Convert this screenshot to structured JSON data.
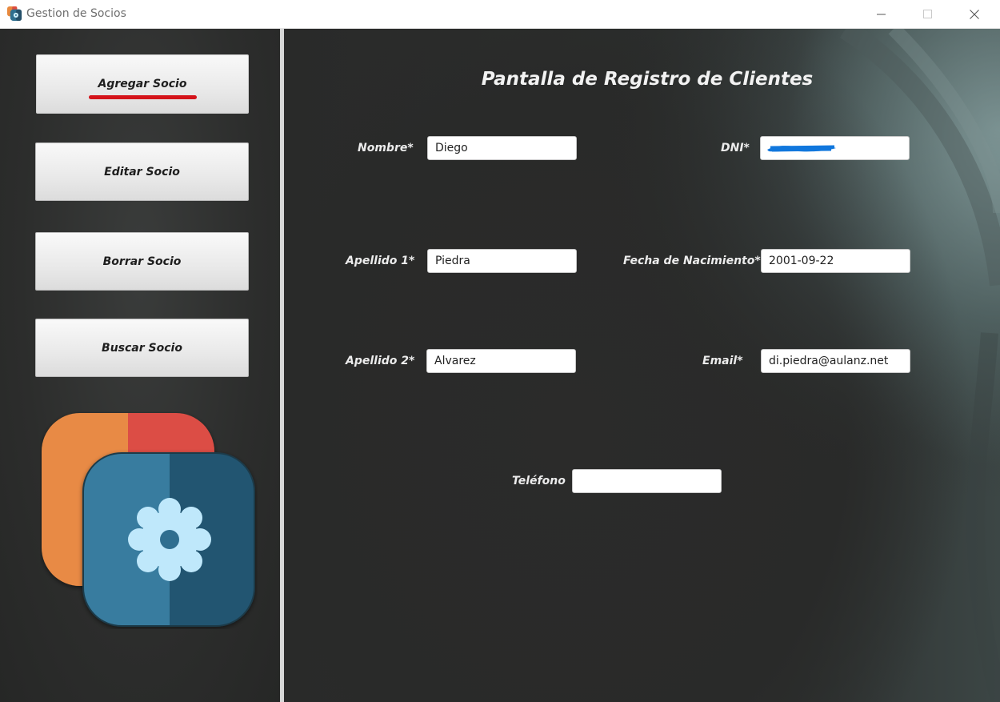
{
  "window": {
    "title": "Gestion de Socios"
  },
  "sidebar": {
    "buttons": [
      {
        "label": "Agregar Socio"
      },
      {
        "label": "Editar Socio"
      },
      {
        "label": "Borrar Socio"
      },
      {
        "label": "Buscar Socio"
      }
    ],
    "logo_icon": "gear-app-logo-icon"
  },
  "form": {
    "title": "Pantalla de Registro de Clientes",
    "nombre": {
      "label": "Nombre*",
      "value": "Diego"
    },
    "dni": {
      "label": "DNI*",
      "value": ""
    },
    "apellido1": {
      "label": "Apellido 1*",
      "value": "Piedra"
    },
    "fecha": {
      "label": "Fecha de Nacimiento*",
      "value": "2001-09-22"
    },
    "apellido2": {
      "label": "Apellido 2*",
      "value": "Alvarez"
    },
    "email": {
      "label": "Email*",
      "value": "di.piedra@aulanz.net"
    },
    "telefono": {
      "label": "Teléfono",
      "value": ""
    }
  },
  "colors": {
    "active_underline": "#d4131a",
    "redaction_scribble": "#1177dd"
  }
}
